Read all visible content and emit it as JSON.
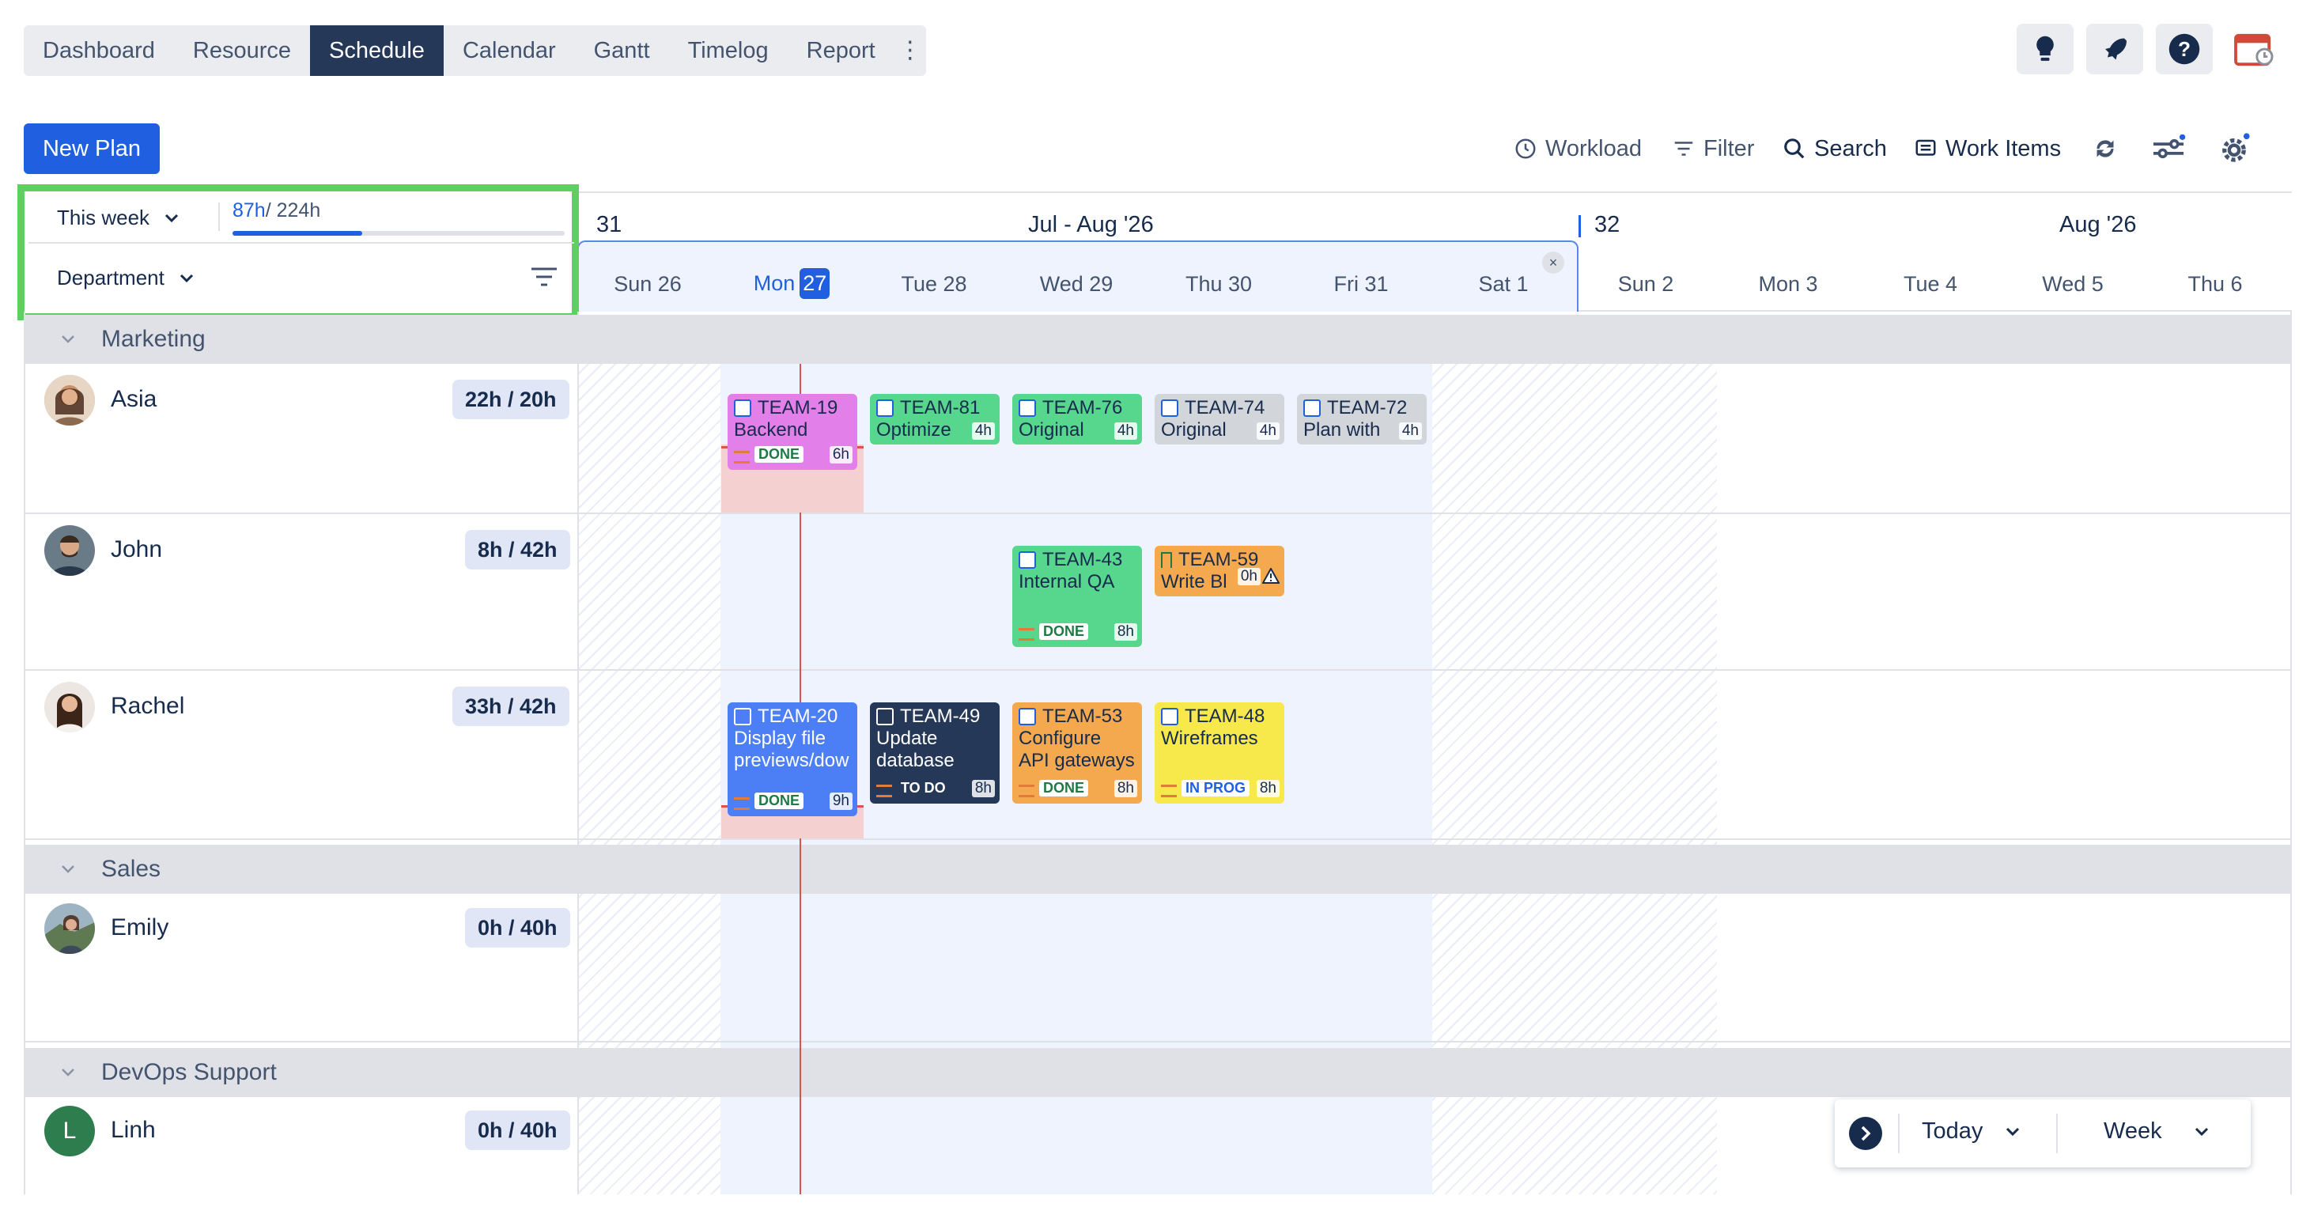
{
  "nav": {
    "tabs": [
      "Dashboard",
      "Resource",
      "Schedule",
      "Calendar",
      "Gantt",
      "Timelog",
      "Report"
    ],
    "active_tab": "Schedule",
    "more_icon": "kebab-icon"
  },
  "top_icons": [
    "lightbulb-icon",
    "rocket-icon",
    "help-icon",
    "calendar-app-icon"
  ],
  "toolbar": {
    "new_plan": "New Plan",
    "workload": "Workload",
    "filter": "Filter",
    "search": "Search",
    "work_items": "Work Items"
  },
  "selector": {
    "period": "This week",
    "logged": "87h",
    "capacity": "/ 224h",
    "progress": 0.39,
    "group_by": "Department"
  },
  "weeks": [
    {
      "number": "31",
      "label": "Jul - Aug '26"
    },
    {
      "number": "32",
      "label": "Aug '26"
    }
  ],
  "days": [
    "Sun 26",
    "Mon",
    "Tue 28",
    "Wed 29",
    "Thu 30",
    "Fri 31",
    "Sat 1",
    "Sun 2",
    "Mon 3",
    "Tue 4",
    "Wed 5",
    "Thu 6"
  ],
  "today_number": "27",
  "close_glyph": "×",
  "groups": [
    {
      "name": "Marketing",
      "people": [
        {
          "name": "Asia",
          "hours": "22h / 20h"
        },
        {
          "name": "John",
          "hours": "8h / 42h"
        },
        {
          "name": "Rachel",
          "hours": "33h / 42h"
        }
      ]
    },
    {
      "name": "Sales",
      "people": [
        {
          "name": "Emily",
          "hours": "0h / 40h"
        }
      ]
    },
    {
      "name": "DevOps Support",
      "people": [
        {
          "name": "Linh",
          "hours": "0h / 40h",
          "initial": "L"
        }
      ]
    }
  ],
  "tasks": {
    "asia": [
      {
        "key": "TEAM-19",
        "title": "Backend",
        "est": "6h",
        "status": "DONE"
      },
      {
        "key": "TEAM-81",
        "title": "Optimize",
        "est": "4h"
      },
      {
        "key": "TEAM-76",
        "title": "Original",
        "est": "4h"
      },
      {
        "key": "TEAM-74",
        "title": "Original",
        "est": "4h"
      },
      {
        "key": "TEAM-72",
        "title": "Plan with",
        "est": "4h"
      }
    ],
    "john": [
      {
        "key": "TEAM-43",
        "title": "Internal QA",
        "est": "8h",
        "status": "DONE"
      },
      {
        "key": "TEAM-59",
        "title": "Write Bl",
        "est": "0h"
      }
    ],
    "rachel": [
      {
        "key": "TEAM-20",
        "title1": "Display file",
        "title2": "previews/dow",
        "est": "9h",
        "status": "DONE"
      },
      {
        "key": "TEAM-49",
        "title1": "Update",
        "title2": "database",
        "est": "8h",
        "status": "TO DO"
      },
      {
        "key": "TEAM-53",
        "title1": "Configure",
        "title2": "API gateways",
        "est": "8h",
        "status": "DONE"
      },
      {
        "key": "TEAM-48",
        "title1": "Wireframes",
        "est": "8h",
        "status": "IN PROG"
      }
    ]
  },
  "footer": {
    "today": "Today",
    "view": "Week"
  },
  "colors": {
    "accent": "#1f5fe0",
    "highlight": "#5fcf5f",
    "today_line": "#d9534f"
  }
}
